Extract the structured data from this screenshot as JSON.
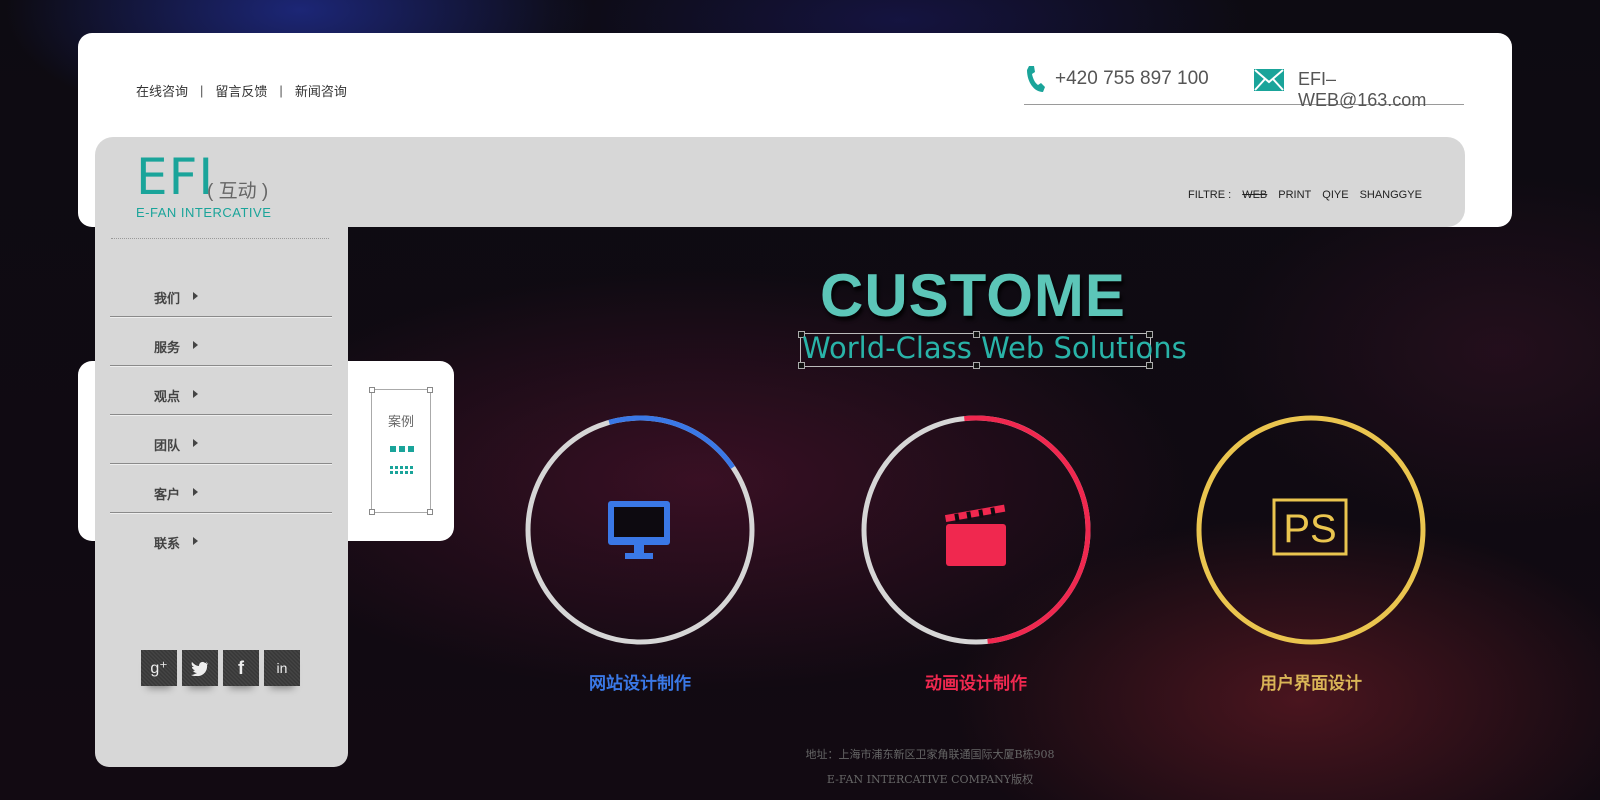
{
  "top_links": [
    "在线咨询",
    "留言反馈",
    "新闻咨询"
  ],
  "top_links_sep": "|",
  "contact": {
    "phone": "+420 755 897 100",
    "email": "EFI–WEB@163.com"
  },
  "logo": {
    "main": "EFI",
    "sub": "( 互动 )",
    "tag": "E-FAN INTERCATIVE"
  },
  "filter": {
    "label": "FILTRE :",
    "items": [
      "WEB",
      "PRINT",
      "QIYE",
      "SHANGGYE"
    ],
    "struck": "WEB"
  },
  "menu": [
    "我们",
    "服务",
    "观点",
    "团队",
    "客户",
    "联系"
  ],
  "case_label": "案例",
  "social": [
    {
      "icon": "google-plus-icon",
      "glyph": "g⁺"
    },
    {
      "icon": "twitter-icon",
      "glyph": "🐦"
    },
    {
      "icon": "facebook-icon",
      "glyph": "f"
    },
    {
      "icon": "linkedin-icon",
      "glyph": "in"
    }
  ],
  "hero": {
    "title": "CUSTOME",
    "subtitle": "World-Class Web Solutions"
  },
  "services": [
    {
      "label": "网站设计制作",
      "icon": "monitor-icon",
      "color": "#3a78e6",
      "progress": 0.2
    },
    {
      "label": "动画设计制作",
      "icon": "clapperboard-icon",
      "color": "#f0284f",
      "progress": 0.5
    },
    {
      "label": "用户界面设计",
      "icon": "ps-icon",
      "icon_text": "PS",
      "color": "#eac54f",
      "progress": 1.0
    }
  ],
  "footer": {
    "address": "地址：上海市浦东新区卫家角联通国际大厦B栋908",
    "copyright": "E-FAN INTERCATIVE COMPANY版权"
  }
}
